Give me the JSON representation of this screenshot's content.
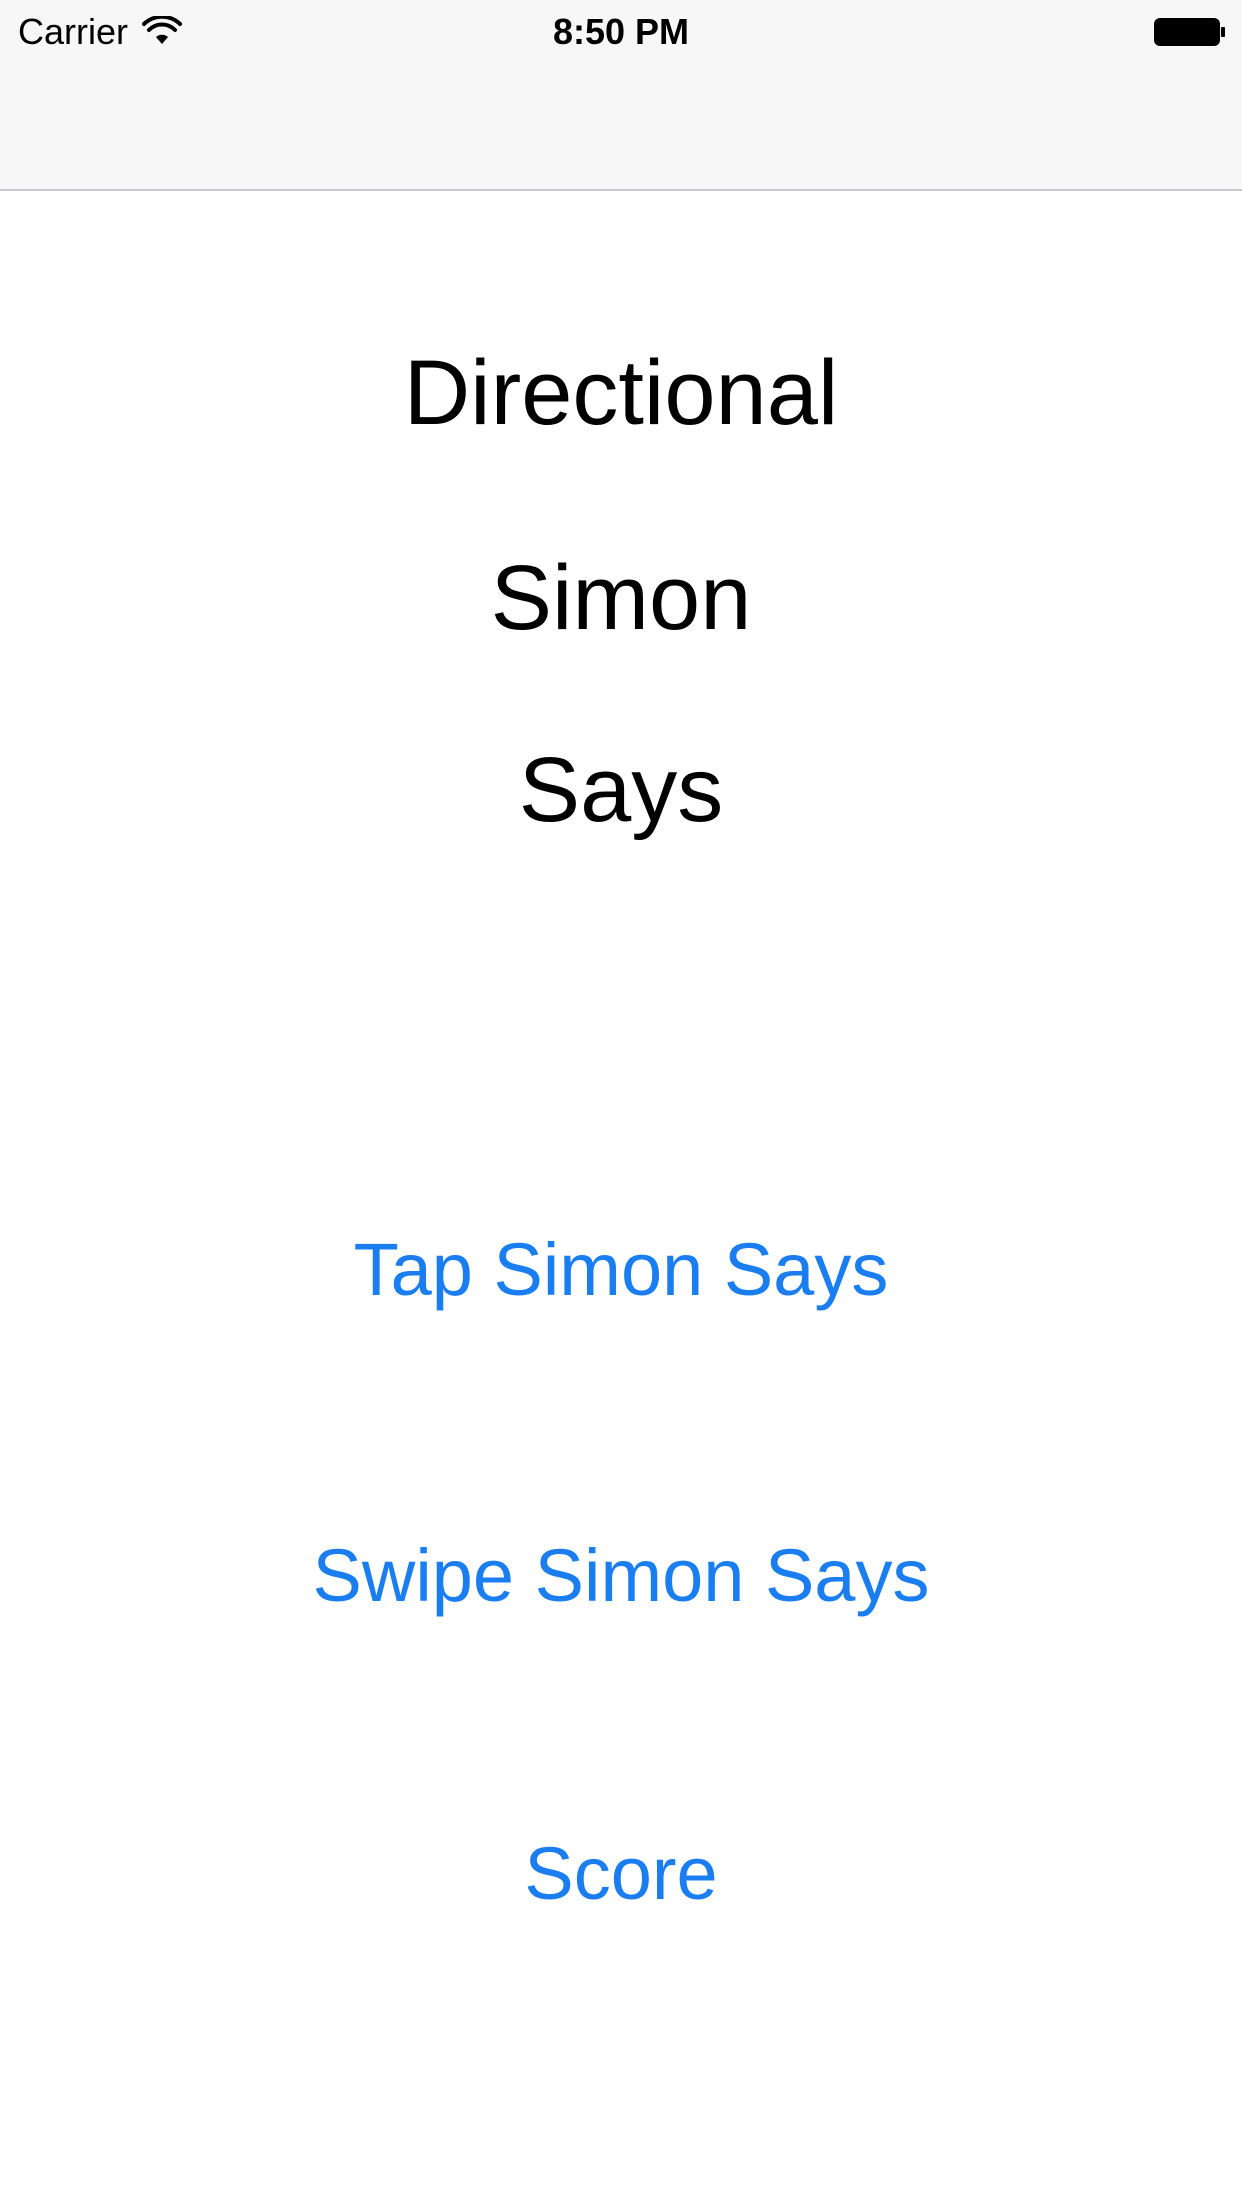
{
  "status_bar": {
    "carrier": "Carrier",
    "time": "8:50 PM",
    "wifi_icon": "wifi-icon",
    "battery_icon": "battery-icon"
  },
  "title": {
    "line1": "Directional",
    "line2": "Simon",
    "line3": "Says"
  },
  "menu": {
    "tap_label": "Tap Simon Says",
    "swipe_label": "Swipe Simon Says",
    "score_label": "Score"
  },
  "colors": {
    "accent": "#1a7ef0",
    "nav_background": "#f7f7f7",
    "text": "#000000"
  }
}
